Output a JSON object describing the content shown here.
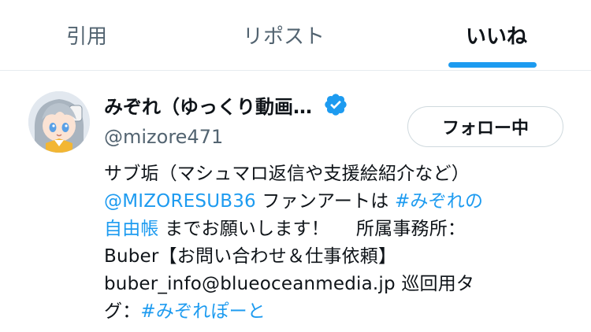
{
  "tabs": [
    {
      "label": "引用"
    },
    {
      "label": "リポスト"
    },
    {
      "label": "いいね"
    }
  ],
  "active_tab": "いいね",
  "accent_color": "#1d9bf0",
  "user": {
    "display_name": "みぞれ（ゆっくり動画…",
    "verified_icon": "verified-badge-icon",
    "handle": "@mizore471",
    "follow_button_label": "フォロー中",
    "avatar_icon": "avatar-anime-girl"
  },
  "bio": {
    "line1": "サブ垢（マシュマロ返信や支援絵紹介など）",
    "line2_mention": "@MIZORESUB36",
    "line2_text": " ファンアートは ",
    "line2_hashtag": "#みぞれの",
    "line3_hashtag": "自由帳",
    "line3_text": " までお願いします！",
    "line3_text2": "所属事務所：",
    "line4": "Buber【お問い合わせ＆仕事依頼】",
    "line5": "buber_info@blueoceanmedia.jp 巡回用タ",
    "line6_text": "グ：",
    "line6_hashtag": "#みぞれぽーと"
  }
}
